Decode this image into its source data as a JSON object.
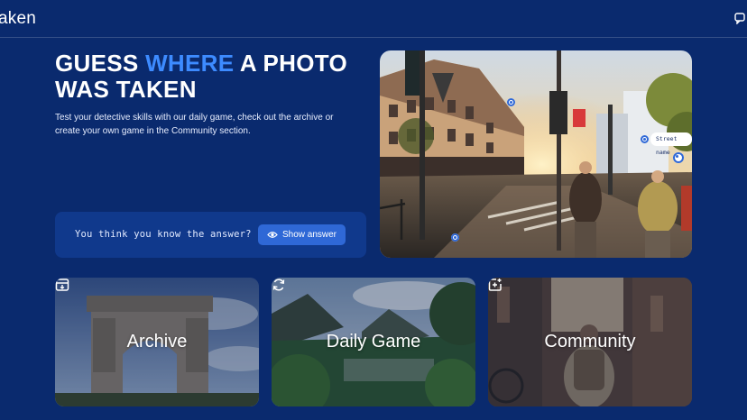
{
  "app": {
    "logo_text": "aken",
    "chat_icon": "chat-icon"
  },
  "hero": {
    "title_part1": "GUESS ",
    "title_accent": "WHERE",
    "title_part2": " A PHOTO WAS TAKEN",
    "description": "Test your detective skills with our daily game, check out the archive or create your own game in the Community section."
  },
  "answer": {
    "prompt": "You think you know the answer?",
    "button_label": "Show answer",
    "button_icon": "eye-icon"
  },
  "photo": {
    "street_label": "Street name"
  },
  "cards": [
    {
      "label": "Archive",
      "icon": "archive-icon"
    },
    {
      "label": "Daily Game",
      "icon": "refresh-icon"
    },
    {
      "label": "Community",
      "icon": "add-square-icon"
    }
  ],
  "colors": {
    "background": "#0a2a6e",
    "accent": "#3d8bff",
    "button": "#2f68d6",
    "panel": "#10398c"
  }
}
